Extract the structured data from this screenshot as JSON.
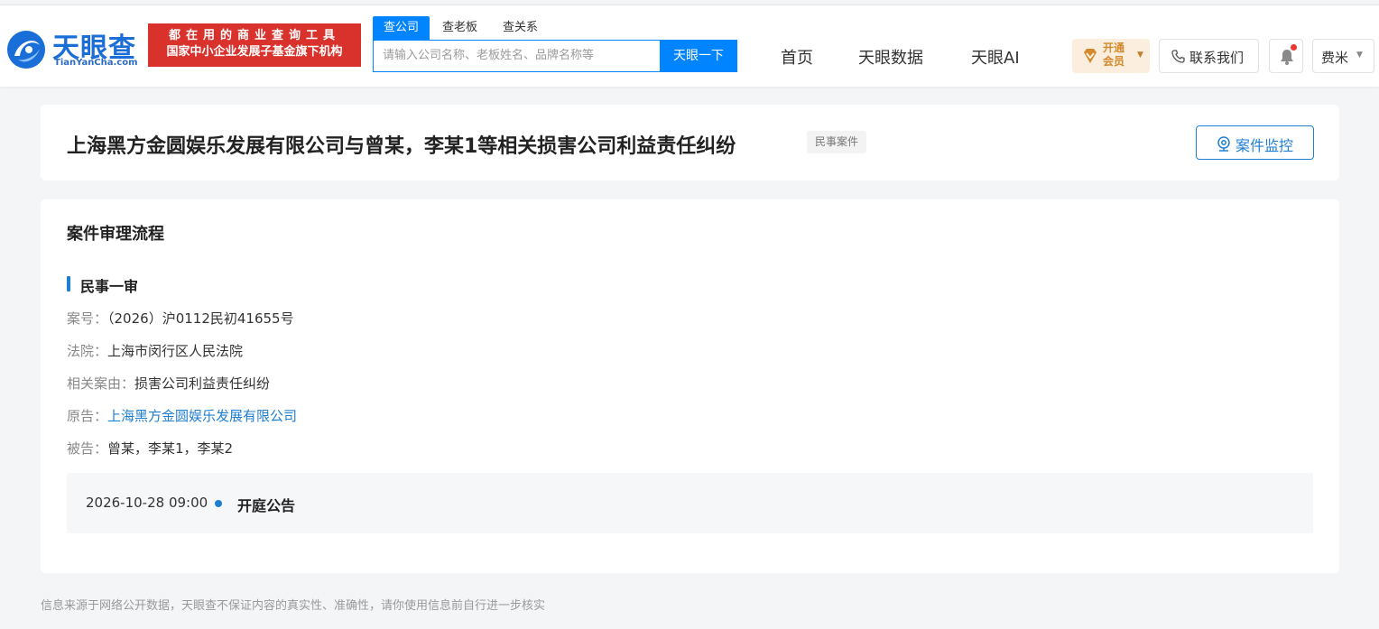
{
  "header": {
    "logo_cn": "天眼查",
    "logo_en": "TianYanCha.com",
    "slogan_line1": "都在用的商业查询工具",
    "slogan_line2": "国家中小企业发展子基金旗下机构",
    "search_tabs": [
      "查公司",
      "查老板",
      "查关系"
    ],
    "search_placeholder": "请输入公司名称、老板姓名、品牌名称等",
    "search_button": "天眼一下",
    "nav": [
      "首页",
      "天眼数据",
      "天眼AI"
    ],
    "vip_line1": "开通",
    "vip_line2": "会员",
    "contact": "联系我们",
    "user": "费米",
    "colors": {
      "brand": "#0084ff",
      "slogan_bg": "#d9312b",
      "vip": "#d48a2c",
      "notice_dot": "#e8382f"
    },
    "icons": [
      "logo-mark-icon",
      "diamond-icon",
      "phone-icon",
      "bell-icon",
      "caret-down-icon"
    ]
  },
  "case": {
    "title": "上海黑方金圆娱乐发展有限公司与曾某，李某1等相关损害公司利益责任纠纷",
    "tag": "民事案件",
    "monitor_button": "案件监控",
    "monitor_icon": "monitor-eye-icon"
  },
  "process": {
    "section_title": "案件审理流程",
    "stage": "民事一审",
    "fields": {
      "case_no_label": "案号：",
      "case_no": "（2026）沪0112民初41655号",
      "court_label": "法院：",
      "court": "上海市闵行区人民法院",
      "cause_label": "相关案由：",
      "cause": "损害公司利益责任纠纷",
      "plaintiff_label": "原告：",
      "plaintiff": "上海黑方金圆娱乐发展有限公司",
      "defendant_label": "被告：",
      "defendant": "曾某，李某1，李某2"
    },
    "timeline": [
      {
        "datetime": "2026-10-28 09:00",
        "event": "开庭公告"
      }
    ]
  },
  "footer": {
    "note": "信息来源于网络公开数据，天眼查不保证内容的真实性、准确性，请你使用信息前自行进一步核实"
  }
}
